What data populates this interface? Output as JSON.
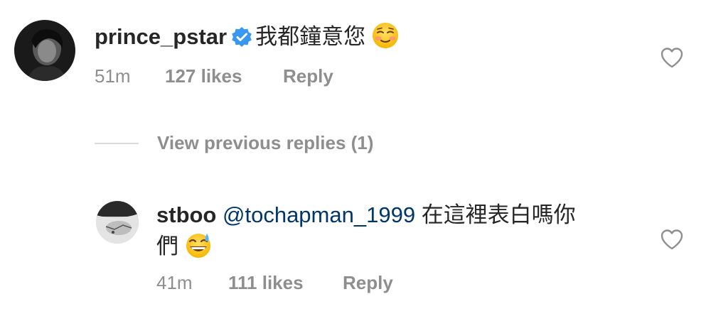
{
  "comment1": {
    "username": "prince_pstar",
    "verified": true,
    "text": "我都鐘意您",
    "emoji": "smiling-face-icon",
    "time": "51m",
    "likes": "127 likes",
    "reply": "Reply"
  },
  "view_previous": {
    "label": "View previous replies (1)"
  },
  "comment2": {
    "username": "stboo",
    "mention": "@tochapman_1999",
    "text_line1": "在這裡表白嗎你",
    "text_line2": "們",
    "emoji": "grinning-sweat-icon",
    "time": "41m",
    "likes": "111 likes",
    "reply": "Reply"
  },
  "colors": {
    "text": "#262626",
    "secondary": "#8e8e8e",
    "mention": "#00376b",
    "verified": "#3897f0",
    "divider": "#dbdbdb"
  }
}
